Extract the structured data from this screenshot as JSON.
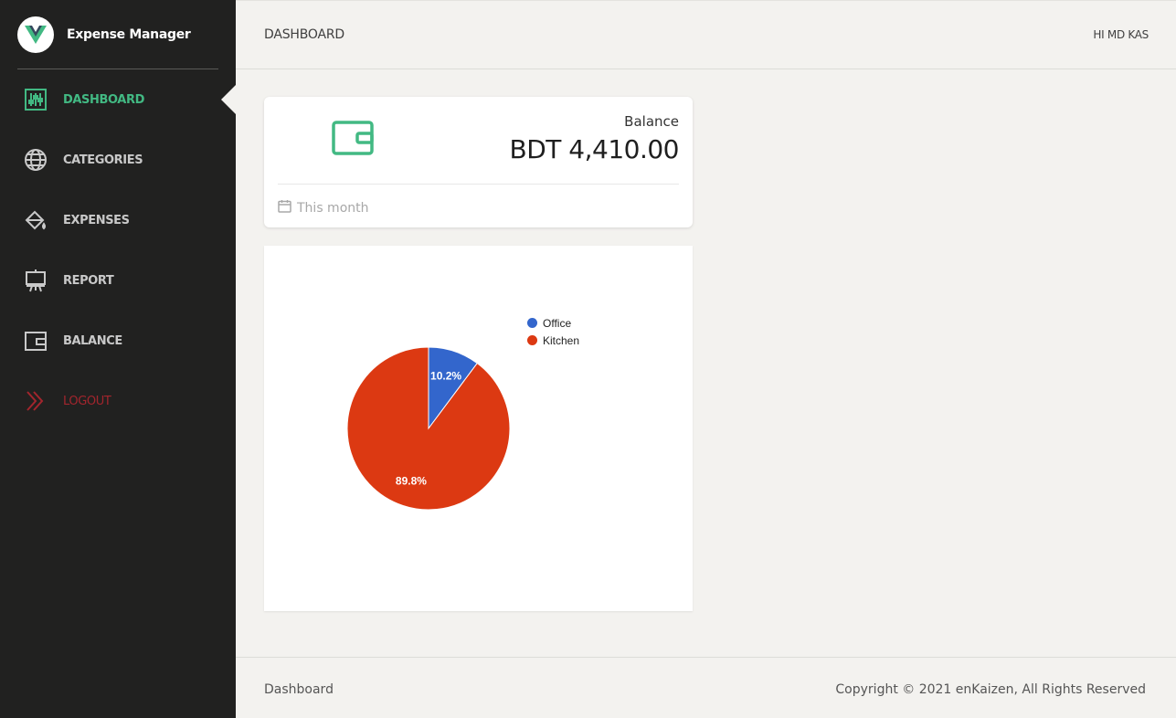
{
  "app": {
    "name": "Expense Manager"
  },
  "header": {
    "title": "DASHBOARD",
    "greeting": "HI MD KAS"
  },
  "sidebar": {
    "items": [
      {
        "label": "DASHBOARD",
        "icon": "sliders-icon"
      },
      {
        "label": "CATEGORIES",
        "icon": "globe-icon"
      },
      {
        "label": "EXPENSES",
        "icon": "paint-bucket-icon"
      },
      {
        "label": "REPORT",
        "icon": "presentation-board-icon"
      },
      {
        "label": "BALANCE",
        "icon": "wallet-icon"
      },
      {
        "label": "LOGOUT",
        "icon": "double-chevron-right-icon"
      }
    ]
  },
  "balance_card": {
    "label": "Balance",
    "value": "BDT 4,410.00",
    "period": "This month",
    "icon": "wallet-icon"
  },
  "chart_data": {
    "type": "pie",
    "categories": [
      "Office",
      "Kitchen"
    ],
    "values": [
      10.2,
      89.8
    ],
    "labels": [
      "10.2%",
      "89.8%"
    ],
    "colors": [
      "#3366cc",
      "#dc3912"
    ],
    "legend": "top-right"
  },
  "footer": {
    "left": "Dashboard",
    "right": "Copyright © 2021 enKaizen, All Rights Reserved"
  },
  "colors": {
    "sidebar_bg": "#212120",
    "accent": "#42b983",
    "logout": "#a3252d",
    "page_bg": "#f3f2ef"
  }
}
